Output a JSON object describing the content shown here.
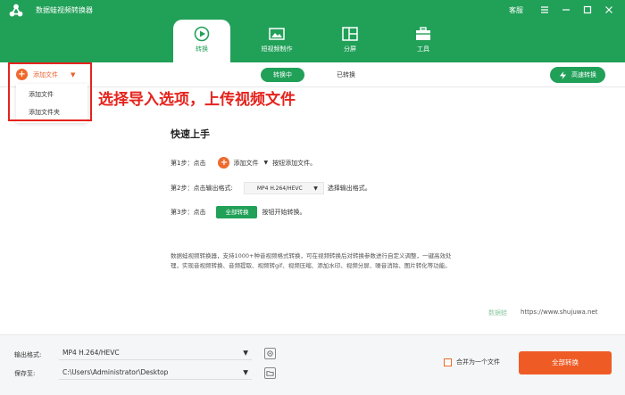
{
  "app": {
    "title": "数据蛙视频转换器",
    "service": "客服"
  },
  "colors": {
    "brand": "#21a058",
    "accent": "#ef6a2d",
    "annotation": "#e5231d"
  },
  "nav_tabs": [
    {
      "label": "转换",
      "icon": "convert-icon",
      "active": true
    },
    {
      "label": "短视频制作",
      "icon": "short-video-icon",
      "active": false
    },
    {
      "label": "分屏",
      "icon": "split-screen-icon",
      "active": false
    },
    {
      "label": "工具",
      "icon": "toolbox-icon",
      "active": false
    }
  ],
  "toolbar": {
    "add_file": "添加文件",
    "segments": [
      "转换中",
      "已转换"
    ],
    "hw_convert": "高速转换"
  },
  "dropdown": {
    "items": [
      "添加文件",
      "添加文件夹"
    ]
  },
  "annotation": "选择导入选项，上传视频文件",
  "quick_start": {
    "title": "快速上手",
    "step1": {
      "prefix": "第1步：点击",
      "btn": "添加文件",
      "suffix": "按钮添加文件。"
    },
    "step2": {
      "prefix": "第2步：点击输出格式:",
      "format": "MP4 H.264/HEVC",
      "suffix": "选择输出格式。"
    },
    "step3": {
      "prefix": "第3步：点击",
      "btn": "全部转换",
      "suffix": "按钮开始转换。"
    },
    "description": "数据蛙视频转换器，支持1000+种音视频格式转换，可在视频转换后对转换参数进行自定义调整，一键高效处理，实现音视频转换、音频提取、视频转gif、视频压缩、添加水印、视频分屏、噪音消除、图片转化等功能。"
  },
  "watermark": {
    "brand": "数据蛙",
    "url": "https://www.shujuwa.net"
  },
  "footer": {
    "output_label": "输出格式:",
    "output_value": "MP4 H.264/HEVC",
    "save_label": "保存至:",
    "save_value": "C:\\Users\\Administrator\\Desktop",
    "merge_label": "合并为一个文件",
    "convert_all": "全部转换"
  }
}
